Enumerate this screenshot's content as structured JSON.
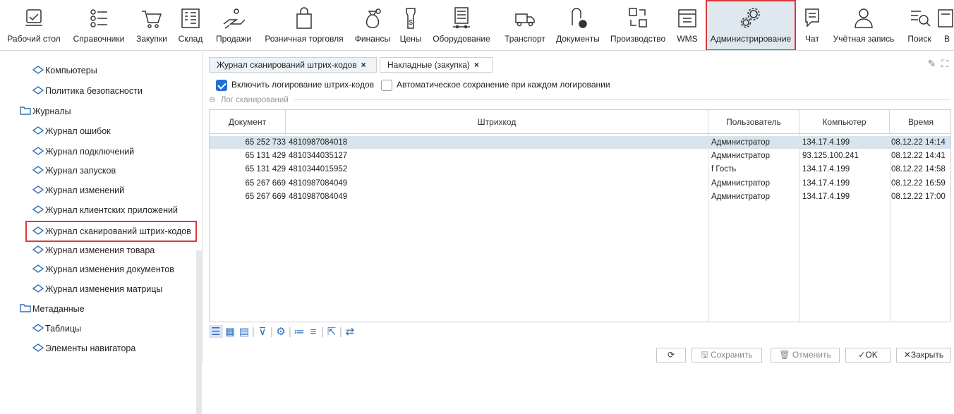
{
  "toolbar": {
    "items": [
      {
        "label": "Рабочий стол",
        "icon": "desktop-icon"
      },
      {
        "label": "Справочники",
        "icon": "list-icon"
      },
      {
        "label": "Закупки",
        "icon": "cart-icon"
      },
      {
        "label": "Склад",
        "icon": "warehouse-icon"
      },
      {
        "label": "Продажи",
        "icon": "hand-coins-icon"
      },
      {
        "label": "Розничная торговля",
        "icon": "shop-icon"
      },
      {
        "label": "Финансы",
        "icon": "money-bag-icon"
      },
      {
        "label": "Цены",
        "icon": "price-tag-icon"
      },
      {
        "label": "Оборудование",
        "icon": "server-icon"
      },
      {
        "label": "Транспорт",
        "icon": "truck-icon"
      },
      {
        "label": "Документы",
        "icon": "document-icon"
      },
      {
        "label": "Производство",
        "icon": "production-icon"
      },
      {
        "label": "WMS",
        "icon": "box-icon"
      },
      {
        "label": "Администрирование",
        "icon": "gears-icon"
      },
      {
        "label": "Чат",
        "icon": "chat-icon"
      },
      {
        "label": "Учётная запись",
        "icon": "user-icon"
      },
      {
        "label": "Поиск",
        "icon": "search-icon"
      },
      {
        "label": "В",
        "icon": "logout-icon"
      }
    ]
  },
  "sidebar": {
    "items": [
      {
        "label": "Компьютеры"
      },
      {
        "label": "Политика безопасности"
      },
      {
        "label": "Журналы"
      },
      {
        "label": "Журнал ошибок"
      },
      {
        "label": "Журнал подключений"
      },
      {
        "label": "Журнал запусков"
      },
      {
        "label": "Журнал изменений"
      },
      {
        "label": "Журнал клиентских приложений"
      },
      {
        "label": "Журнал сканирований штрих-кодов"
      },
      {
        "label": "Журнал изменения товара"
      },
      {
        "label": "Журнал изменения документов"
      },
      {
        "label": "Журнал изменения матрицы"
      },
      {
        "label": "Метаданные"
      },
      {
        "label": "Таблицы"
      },
      {
        "label": "Элементы навигатора"
      }
    ]
  },
  "tabs": [
    {
      "label": "Журнал сканирований штрих-кодов",
      "close": "×"
    },
    {
      "label": "Накладные (закупка)",
      "close": "×"
    }
  ],
  "options": {
    "log_barcodes": "Включить логирование штрих-кодов",
    "autosave": "Автоматическое сохранение при каждом логировании"
  },
  "group": {
    "title": "Лог сканирований",
    "collapse": "⊖"
  },
  "table": {
    "headers": [
      "Документ",
      "Штрихкод",
      "Пользователь",
      "Компьютер",
      "Время"
    ],
    "rows": [
      {
        "doc": "65 252 733",
        "barcode": "4810987084018",
        "user": "Администратор",
        "computer": "134.17.4.199",
        "time": "08.12.22 14:14"
      },
      {
        "doc": "65 131 429",
        "barcode": "4810344035127",
        "user": "Администратор",
        "computer": "93.125.100.241",
        "time": "08.12.22 14:41"
      },
      {
        "doc": "65 131 429",
        "barcode": "4810344015952",
        "user": "f Гость",
        "computer": "134.17.4.199",
        "time": "08.12.22 14:58"
      },
      {
        "doc": "65 267 669",
        "barcode": "4810987084049",
        "user": "Администратор",
        "computer": "134.17.4.199",
        "time": "08.12.22 16:59"
      },
      {
        "doc": "65 267 669",
        "barcode": "4810987084049",
        "user": "Администратор",
        "computer": "134.17.4.199",
        "time": "08.12.22 17:00"
      }
    ]
  },
  "buttons": {
    "refresh": "⟳",
    "save": "Сохранить",
    "cancel": "Отменить",
    "ok": "OK",
    "close": "Закрыть"
  },
  "colors": {
    "accent": "#1e6fd9",
    "highlight": "#d93a3a",
    "selected_row": "#d7e4ed",
    "icon_blue": "#2d6fc4"
  }
}
